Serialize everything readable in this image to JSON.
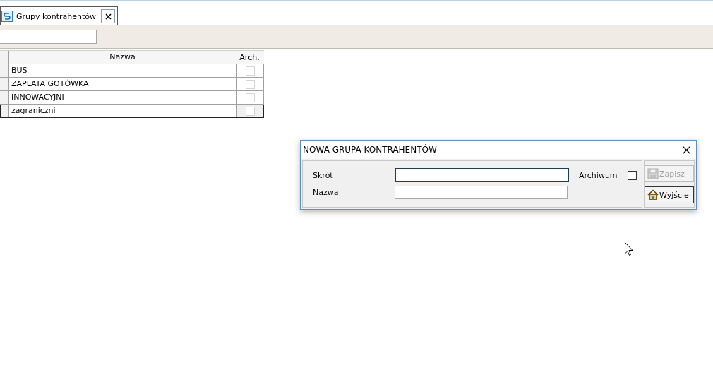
{
  "tabs": [
    {
      "label": "Grupy kontrahentów",
      "selected": true
    }
  ],
  "table": {
    "columns": [
      "Nazwa",
      "Arch."
    ],
    "rows": [
      {
        "name": "BUS",
        "archived": false,
        "selected": false
      },
      {
        "name": "ZAPLATA GOTÓWKA",
        "archived": false,
        "selected": false
      },
      {
        "name": "INNOWACYJNI",
        "archived": false,
        "selected": false
      },
      {
        "name": "zagraniczni",
        "archived": false,
        "selected": true
      }
    ]
  },
  "dialog": {
    "title": "NOWA GRUPA KONTRAHENTÓW",
    "fields": [
      {
        "label": "Skrót",
        "focused": true
      },
      {
        "label": "Nazwa",
        "focused": false
      }
    ],
    "archive": {
      "label": "Archiwum",
      "checked": false
    },
    "buttons": [
      {
        "kind": "save",
        "label": "Zapisz",
        "disabled": true
      },
      {
        "kind": "exit",
        "label": "Wyjście",
        "disabled": false
      }
    ]
  }
}
